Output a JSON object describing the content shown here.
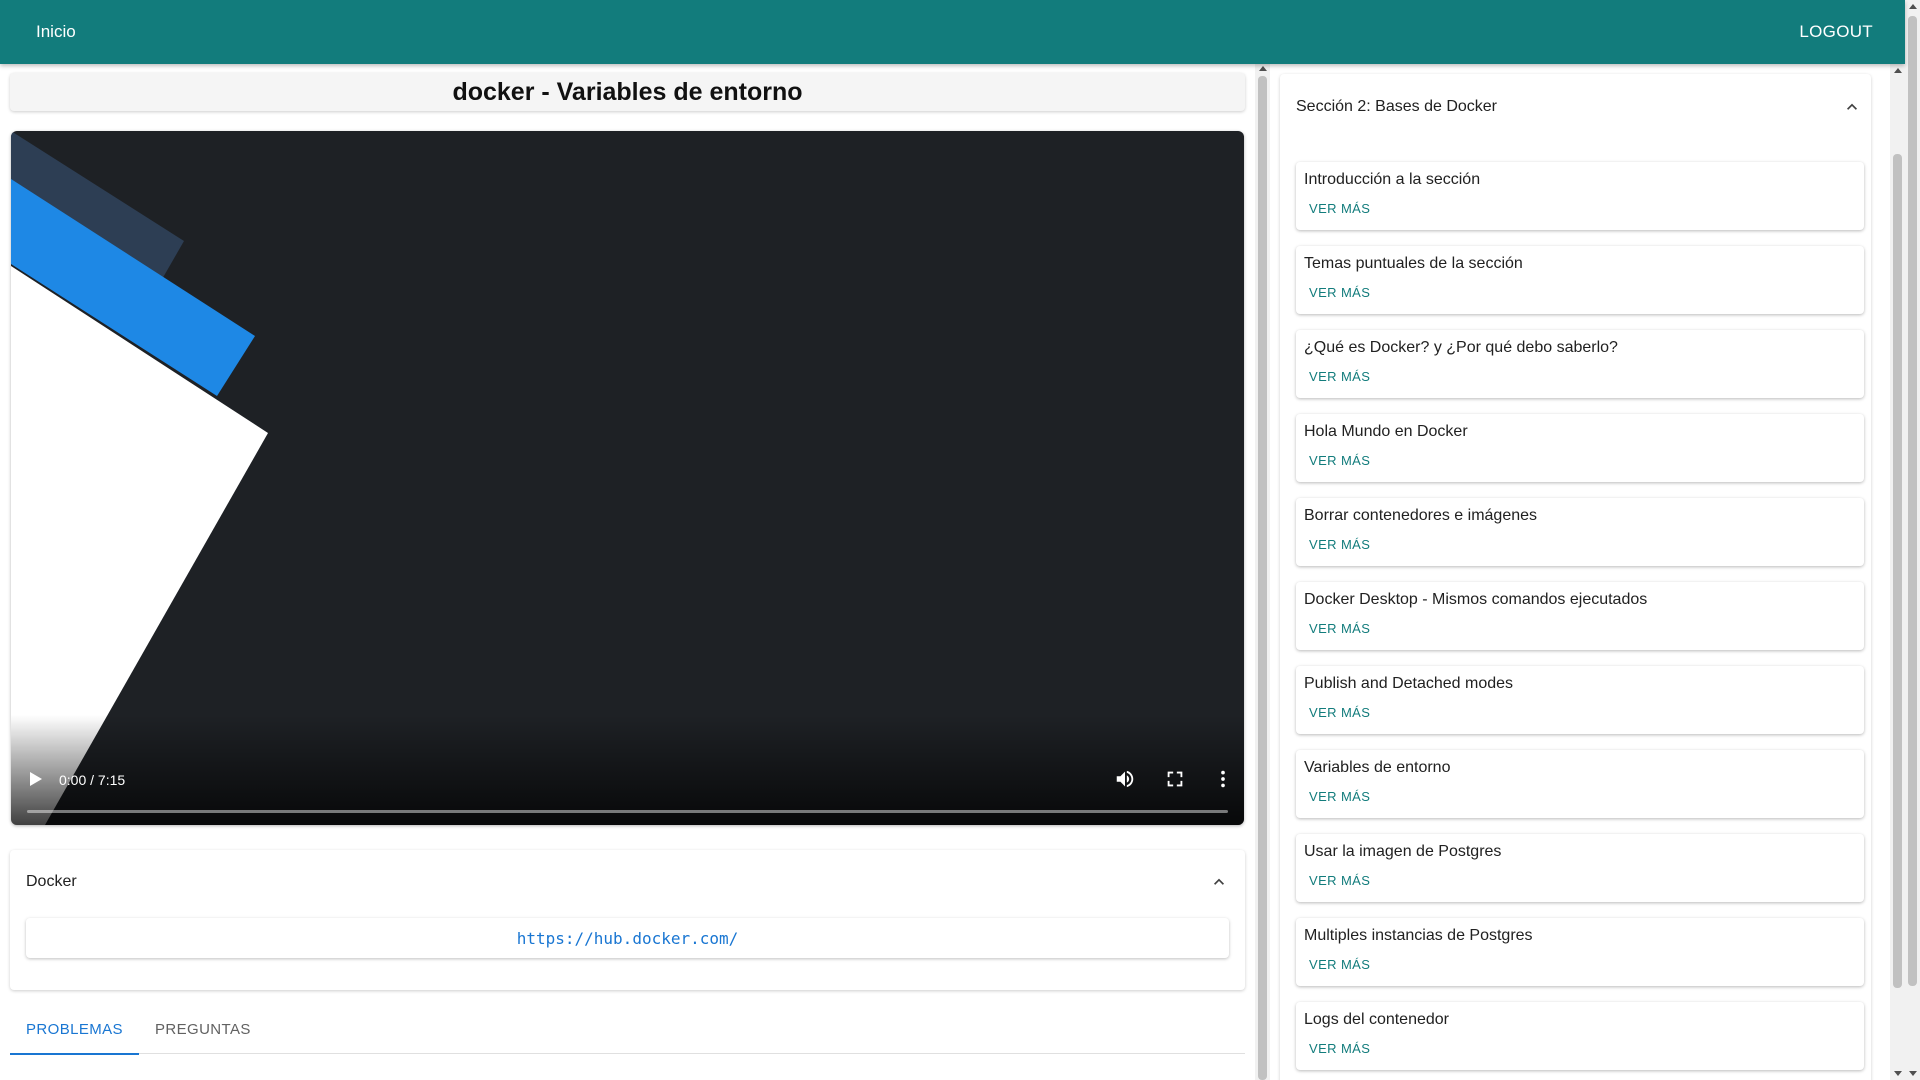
{
  "colors": {
    "appbar": "#127c7c",
    "accent": "#1976d2",
    "link_button": "#127c7c",
    "video_bg": "#1e2125"
  },
  "appbar": {
    "home_label": "Inicio",
    "logout_label": "LOGOUT"
  },
  "lesson": {
    "title": "docker - Variables de entorno",
    "video": {
      "time_display": "0:00 / 7:15",
      "progress": 0
    },
    "resources": {
      "heading": "Docker",
      "link": "https://hub.docker.com/"
    },
    "tabs": [
      {
        "label": "PROBLEMAS",
        "active": true
      },
      {
        "label": "PREGUNTAS",
        "active": false
      }
    ]
  },
  "section": {
    "title": "Sección 2: Bases de Docker",
    "more_label": "VER MÁS",
    "items": [
      {
        "label": "Introducción a la sección"
      },
      {
        "label": "Temas puntuales de la sección"
      },
      {
        "label": "¿Qué es Docker? y ¿Por qué debo saberlo?"
      },
      {
        "label": "Hola Mundo en Docker"
      },
      {
        "label": "Borrar contenedores e imágenes"
      },
      {
        "label": "Docker Desktop - Mismos comandos ejecutados"
      },
      {
        "label": "Publish and Detached modes"
      },
      {
        "label": "Variables de entorno"
      },
      {
        "label": "Usar la imagen de Postgres"
      },
      {
        "label": "Multiples instancias de Postgres"
      },
      {
        "label": "Logs del contenedor"
      }
    ]
  }
}
